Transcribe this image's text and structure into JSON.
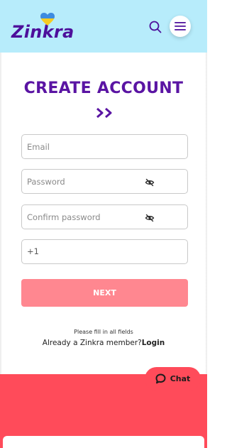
{
  "header": {
    "logo_text": "Zinkra",
    "search_icon": "search-icon",
    "menu_icon": "hamburger-menu-icon"
  },
  "colors": {
    "header_bg": "#b7ecfb",
    "brand_purple": "#5a14a3",
    "next_button": "#ff8790",
    "footer_bg": "#ff4b5a"
  },
  "form": {
    "title": "CREATE ACCOUNT",
    "title_icon": "double-chevron-right-icon",
    "email_placeholder": "Email",
    "password_placeholder": "Password",
    "confirm_password_placeholder": "Confirm password",
    "password_toggle_icon": "eye-slash-icon",
    "phone_prefix": "+1",
    "next_label": "NEXT",
    "hint": "Please fill in all fields",
    "member_text": "Already a Zinkra member?",
    "login_label": "Login"
  },
  "chat": {
    "label": "Chat",
    "icon": "chat-bubble-icon"
  }
}
